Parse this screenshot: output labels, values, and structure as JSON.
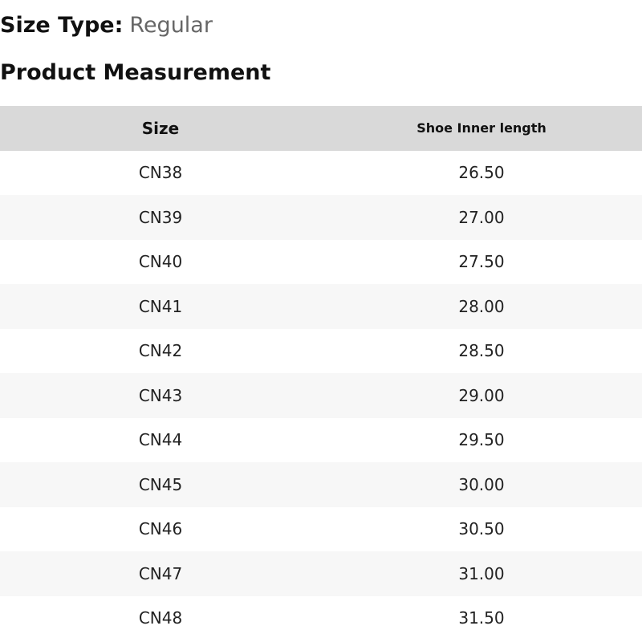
{
  "header": {
    "size_type_label": "Size Type:",
    "size_type_value": "Regular",
    "section_title": "Product Measurement"
  },
  "table": {
    "columns": [
      "Size",
      "Shoe Inner length"
    ],
    "rows": [
      {
        "size": "CN38",
        "length": "26.50"
      },
      {
        "size": "CN39",
        "length": "27.00"
      },
      {
        "size": "CN40",
        "length": "27.50"
      },
      {
        "size": "CN41",
        "length": "28.00"
      },
      {
        "size": "CN42",
        "length": "28.50"
      },
      {
        "size": "CN43",
        "length": "29.00"
      },
      {
        "size": "CN44",
        "length": "29.50"
      },
      {
        "size": "CN45",
        "length": "30.00"
      },
      {
        "size": "CN46",
        "length": "30.50"
      },
      {
        "size": "CN47",
        "length": "31.00"
      },
      {
        "size": "CN48",
        "length": "31.50"
      }
    ]
  },
  "colors": {
    "header_bg": "#d9d9d9",
    "alt_row_bg": "#f7f7f7",
    "value_grey": "#666666"
  }
}
